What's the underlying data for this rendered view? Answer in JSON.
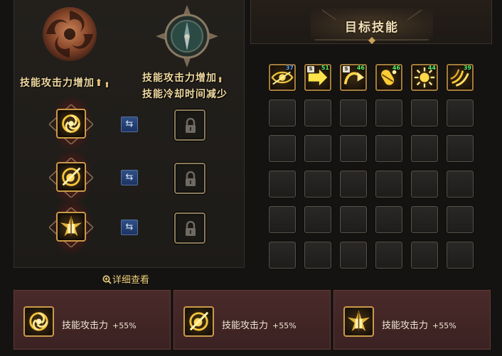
{
  "left_panel": {
    "caption_a": "技能攻击力增加",
    "caption_b_line1": "技能攻击力增加",
    "caption_b_line2": "技能冷却时间减少",
    "emblem_a_icon": "vortex-emblem-icon",
    "emblem_b_icon": "compass-emblem-icon",
    "rows": [
      {
        "skill_icon": "vortex-skill-icon",
        "swap_icon": "swap-arrows-icon",
        "lock_icon": "lock-icon"
      },
      {
        "skill_icon": "orb-slash-skill-icon",
        "swap_icon": "swap-arrows-icon",
        "lock_icon": "lock-icon"
      },
      {
        "skill_icon": "spike-burst-skill-icon",
        "swap_icon": "swap-arrows-icon",
        "lock_icon": "lock-icon"
      }
    ],
    "swap_glyph": "⇆",
    "detail_link": "详细查看"
  },
  "right_panel": {
    "title": "目标技能",
    "skills": [
      {
        "level": "37",
        "level_color": "blue",
        "s_badge": "",
        "icon": "eye-skill-icon"
      },
      {
        "level": "51",
        "level_color": "green",
        "s_badge": "S",
        "icon": "arrow-skill-icon"
      },
      {
        "level": "46",
        "level_color": "green",
        "s_badge": "S",
        "icon": "curve-arrow-skill-icon"
      },
      {
        "level": "46",
        "level_color": "green",
        "s_badge": "",
        "icon": "capsule-skill-icon"
      },
      {
        "level": "44",
        "level_color": "green",
        "s_badge": "",
        "icon": "sun-skill-icon"
      },
      {
        "level": "39",
        "level_color": "green",
        "s_badge": "",
        "icon": "claw-skill-icon"
      }
    ],
    "empty_rows": 5,
    "columns": 6
  },
  "cards": [
    {
      "label": "技能攻击力",
      "value": "+55%",
      "icon": "vortex-skill-icon"
    },
    {
      "label": "技能攻击力",
      "value": "+55%",
      "icon": "orb-slash-skill-icon"
    },
    {
      "label": "技能攻击力",
      "value": "+55%",
      "icon": "spike-burst-skill-icon"
    }
  ],
  "colors": {
    "gold": "#c99b48",
    "card_bg": "#4a2a2a",
    "level_green": "#5cf06a",
    "level_blue": "#5aa7ff",
    "swap_blue": "#2f4f86"
  }
}
